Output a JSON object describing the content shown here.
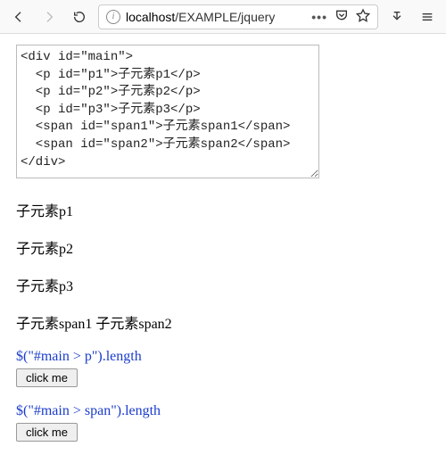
{
  "toolbar": {
    "url_host": "localhost",
    "url_path": "/EXAMPLE/jquery"
  },
  "codebox": {
    "value": "<div id=\"main\">\n  <p id=\"p1\">子元素p1</p>\n  <p id=\"p2\">子元素p2</p>\n  <p id=\"p3\">子元素p3</p>\n  <span id=\"span1\">子元素span1</span>\n  <span id=\"span2\">子元素span2</span>\n</div>"
  },
  "rendered": {
    "p1": "子元素p1",
    "p2": "子元素p2",
    "p3": "子元素p3",
    "span1": "子元素span1",
    "span2": "子元素span2"
  },
  "selectors": {
    "first": {
      "label": "$(\"#main > p\").length",
      "button": "click me"
    },
    "second": {
      "label": "$(\"#main > span\").length",
      "button": "click me"
    }
  }
}
